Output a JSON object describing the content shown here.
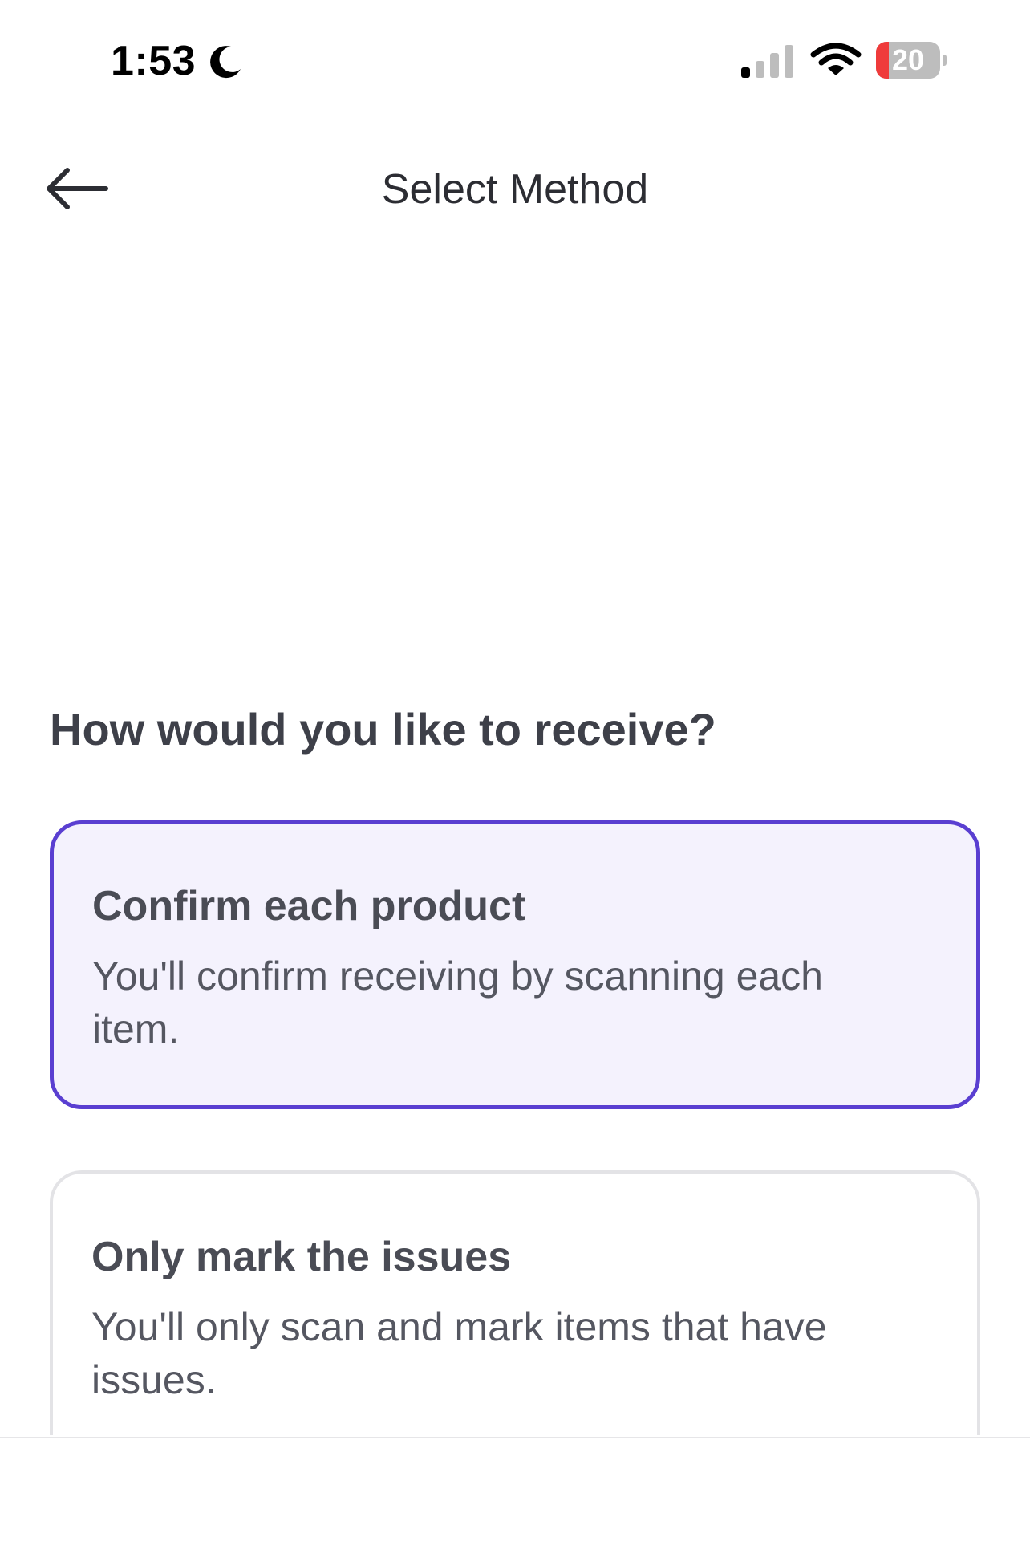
{
  "status_bar": {
    "time": "1:53",
    "battery_level": "20",
    "battery_fraction": 0.2,
    "colors": {
      "battery_low": "#ef3b3b"
    },
    "icons": [
      "moon-icon",
      "cellular-signal-icon",
      "wifi-icon",
      "battery-icon"
    ]
  },
  "header": {
    "title": "Select Method",
    "back_icon": "arrow-left-icon"
  },
  "question": "How would you like to receive?",
  "options": [
    {
      "title": "Confirm each product",
      "description": "You'll confirm receiving by scanning each item.",
      "selected": true
    },
    {
      "title": "Only mark the issues",
      "description": "You'll only scan and mark items that have issues.",
      "selected": false
    }
  ],
  "colors": {
    "accent": "#5a3fd1",
    "selected_background": "#f4f2fd",
    "card_border": "#e3e3e6"
  }
}
